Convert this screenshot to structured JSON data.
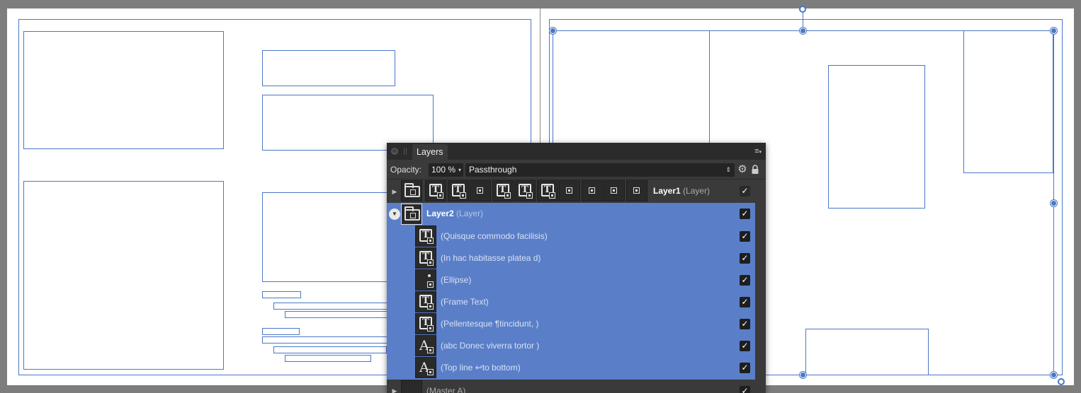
{
  "panel": {
    "tab_title": "Layers",
    "menu_icon": "≡",
    "close_icon": "⊗",
    "opacity_label": "Opacity:",
    "opacity_value": "100 %",
    "blend_mode": "Passthrough",
    "gear_icon": "⚙"
  },
  "layers": [
    {
      "name": "Layer1",
      "type": "(Layer)",
      "expanded": false,
      "visible": true,
      "child_thumbs": [
        "text-frame",
        "text-frame",
        "empty",
        "text-frame",
        "text-frame",
        "text-frame",
        "empty",
        "empty",
        "empty",
        "empty"
      ]
    },
    {
      "name": "Layer2",
      "type": "(Layer)",
      "expanded": true,
      "visible": true,
      "selected": true,
      "children": [
        {
          "name": "(Quisque commodo facilisis)",
          "kind": "text-frame",
          "visible": true
        },
        {
          "name": "(In hac habitasse platea d)",
          "kind": "text-frame",
          "visible": true
        },
        {
          "name": "(Ellipse)",
          "kind": "ellipse",
          "visible": true
        },
        {
          "name": "(Frame Text)",
          "kind": "text-frame",
          "visible": true
        },
        {
          "name": "(Pellentesque ¶tincidunt, )",
          "kind": "text-frame",
          "visible": true
        },
        {
          "name": "(abc Donec viverra tortor )",
          "kind": "artistic-text",
          "visible": true
        },
        {
          "name": "(Top line ↩to bottom)",
          "kind": "artistic-text",
          "visible": true
        }
      ]
    },
    {
      "name": "(Master A)",
      "type": "",
      "expanded": false,
      "visible": true
    }
  ],
  "check_glyph": "✓",
  "colors": {
    "accent": "#4a78c6",
    "selection_row": "#5a7fc8",
    "panel_bg": "#3a3a3a",
    "pasteboard": "#7d7d7d"
  }
}
